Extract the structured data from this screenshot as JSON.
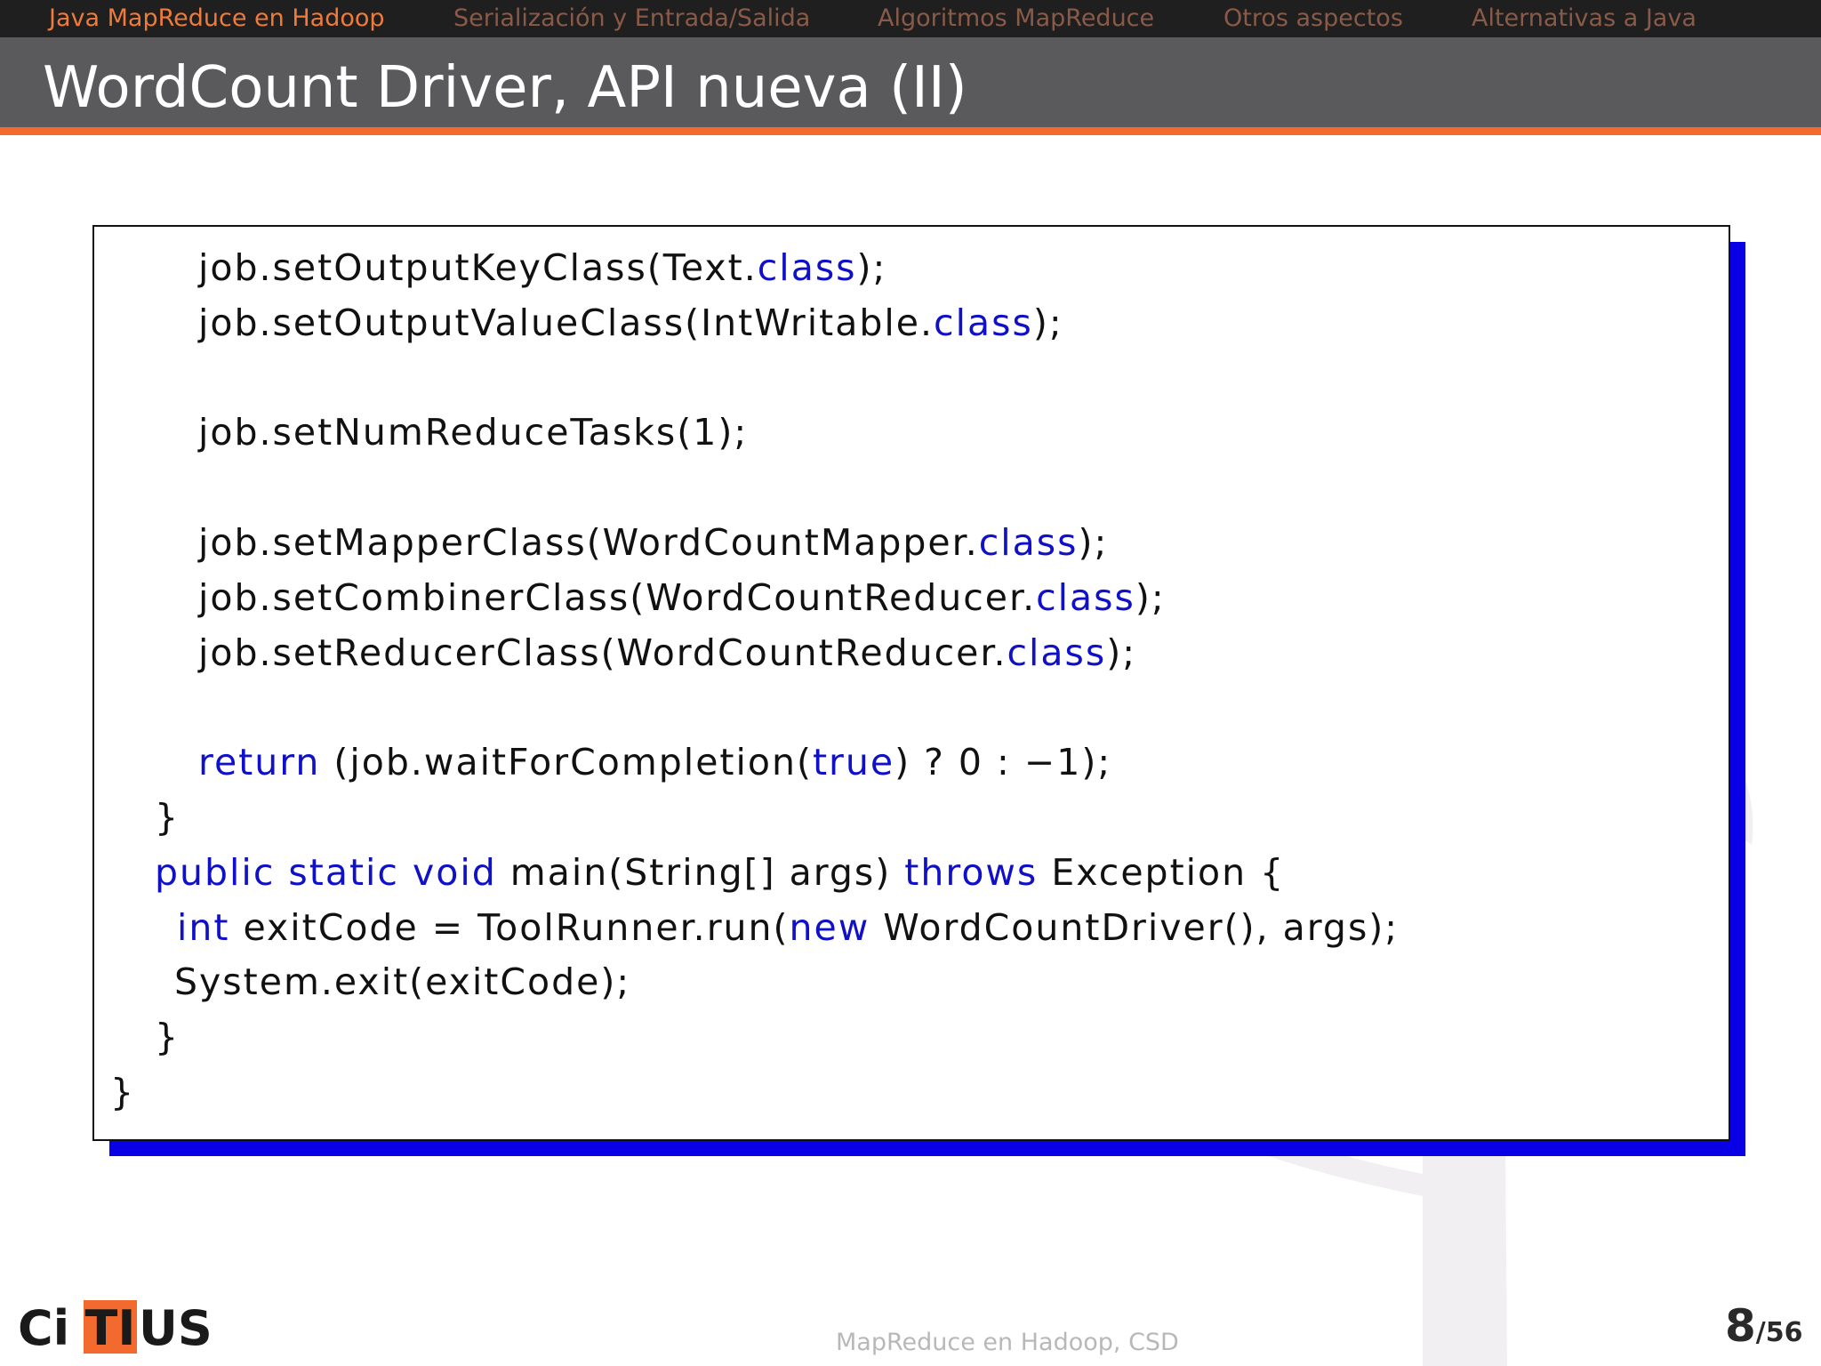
{
  "nav": {
    "items": [
      {
        "label": "Java MapReduce en Hadoop",
        "active": true
      },
      {
        "label": "Serialización y Entrada/Salida",
        "active": false
      },
      {
        "label": "Algoritmos MapReduce",
        "active": false
      },
      {
        "label": "Otros aspectos",
        "active": false
      },
      {
        "label": "Alternativas a Java",
        "active": false
      }
    ]
  },
  "slide": {
    "title": "WordCount Driver, API nueva (II)"
  },
  "code": {
    "lines": [
      [
        {
          "t": "job.setOutputKeyClass(Text."
        },
        {
          "t": "class",
          "kw": true
        },
        {
          "t": ");"
        }
      ],
      [
        {
          "t": "job.setOutputValueClass(IntWritable."
        },
        {
          "t": "class",
          "kw": true
        },
        {
          "t": ");"
        }
      ],
      [],
      [
        {
          "t": "job.setNumReduceTasks(1);"
        }
      ],
      [],
      [
        {
          "t": "job.setMapperClass(WordCountMapper."
        },
        {
          "t": "class",
          "kw": true
        },
        {
          "t": ");"
        }
      ],
      [
        {
          "t": "job.setCombinerClass(WordCountReducer."
        },
        {
          "t": "class",
          "kw": true
        },
        {
          "t": ");"
        }
      ],
      [
        {
          "t": "job.setReducerClass(WordCountReducer."
        },
        {
          "t": "class",
          "kw": true
        },
        {
          "t": ");"
        }
      ],
      [],
      [
        {
          "t": "return",
          "kw": true
        },
        {
          "t": " (job.waitForCompletion("
        },
        {
          "t": "true",
          "kw": true
        },
        {
          "t": ") ? 0 : −1);"
        }
      ],
      [
        {
          "t": "}"
        }
      ],
      [
        {
          "t": "public static void",
          "kw": true
        },
        {
          "t": " main(String[] args) "
        },
        {
          "t": "throws",
          "kw": true
        },
        {
          "t": " Exception {"
        }
      ],
      [
        {
          "t": "int",
          "kw": true
        },
        {
          "t": " exitCode = ToolRunner.run("
        },
        {
          "t": "new",
          "kw": true
        },
        {
          "t": " WordCountDriver(), args);"
        }
      ],
      [
        {
          "t": "System.exit(exitCode);"
        }
      ],
      [
        {
          "t": "}"
        }
      ],
      [
        {
          "t": "}"
        }
      ]
    ]
  },
  "footer": {
    "logo_left": "Ci",
    "logo_box": "TI",
    "logo_right": "US",
    "center_text": "MapReduce en Hadoop, CSD",
    "page_current": "8",
    "page_total": "/56"
  },
  "colors": {
    "accent": "#f26a2e",
    "keyword": "#1010c8",
    "shadow": "#0a00e6"
  }
}
